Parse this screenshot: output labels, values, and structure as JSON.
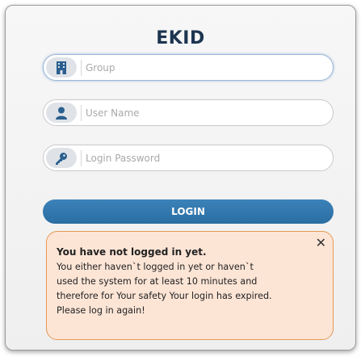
{
  "app": {
    "title": "EKID"
  },
  "form": {
    "group": {
      "placeholder": "Group",
      "value": "",
      "icon": "building-icon"
    },
    "username": {
      "placeholder": "User Name",
      "value": "",
      "icon": "user-icon"
    },
    "password": {
      "placeholder": "Login Password",
      "value": "",
      "icon": "key-icon"
    },
    "login_label": "LOGIN"
  },
  "alert": {
    "heading": "You have not logged in yet.",
    "lines": [
      "You either haven`t logged in yet or haven`t",
      "used the system for at least 10 minutes and",
      "therefore for Your safety Your login has expired.",
      "Please log in again!"
    ],
    "close_symbol": "✕"
  },
  "colors": {
    "title": "#1c3550",
    "icon": "#2a5f8f",
    "button": "#2f78ad",
    "alert_bg": "#fde5d6",
    "alert_border": "#e39a55"
  }
}
